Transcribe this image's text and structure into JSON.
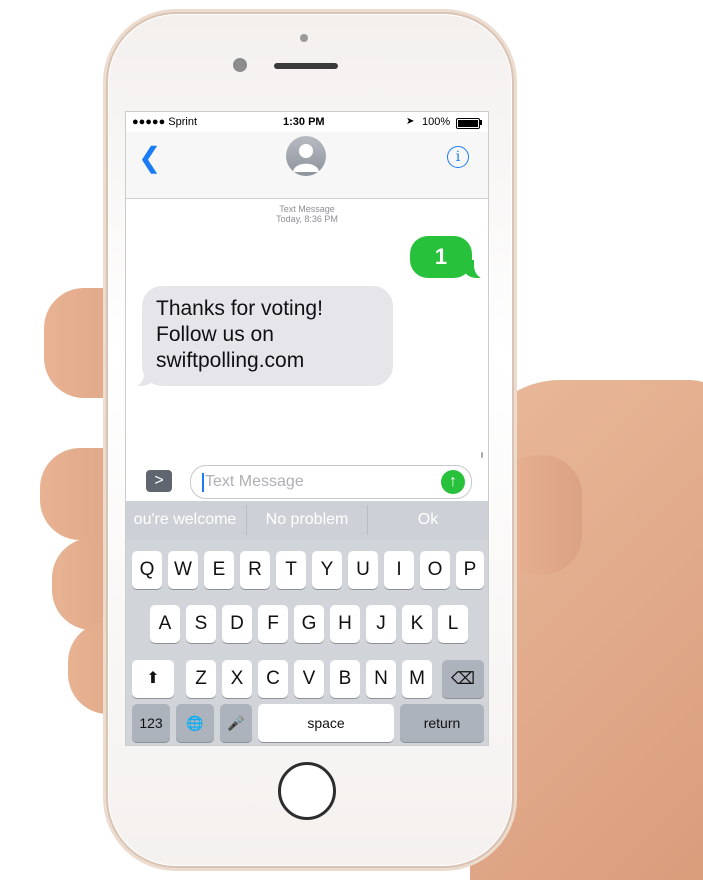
{
  "status_bar": {
    "carrier": "●●●●● Sprint",
    "time": "1:30 PM",
    "battery": "100%",
    "location_icon": "location-arrow-icon"
  },
  "nav": {
    "back_icon": "chevron-left-icon",
    "avatar_icon": "contact-avatar-icon",
    "info_icon": "info-icon",
    "info_glyph": "i"
  },
  "conversation": {
    "meta_line1": "Text Message",
    "meta_line2": "Today, 8:36 PM",
    "sent_message": "1",
    "received_line1": "Thanks for voting!",
    "received_line2": "Follow us on",
    "received_line3": "swiftpolling.com",
    "colors": {
      "sent_bubble": "#27c13b",
      "received_bubble": "#e5e5ea",
      "accent": "#1a7cf5"
    }
  },
  "input": {
    "expand_glyph": ">",
    "placeholder": "Text Message",
    "send_glyph": "↑"
  },
  "keyboard": {
    "suggestions": [
      "ou're welcome",
      "No problem",
      "Ok"
    ],
    "row1": [
      "Q",
      "W",
      "E",
      "R",
      "T",
      "Y",
      "U",
      "I",
      "O",
      "P"
    ],
    "row2": [
      "A",
      "S",
      "D",
      "F",
      "G",
      "H",
      "J",
      "K",
      "L"
    ],
    "row3": [
      "Z",
      "X",
      "C",
      "V",
      "B",
      "N",
      "M"
    ],
    "shift_glyph": "⬆",
    "delete_glyph": "⌫",
    "numbers_label": "123",
    "globe_glyph": "🌐",
    "mic_glyph": "🎤",
    "space_label": "space",
    "return_label": "return"
  }
}
